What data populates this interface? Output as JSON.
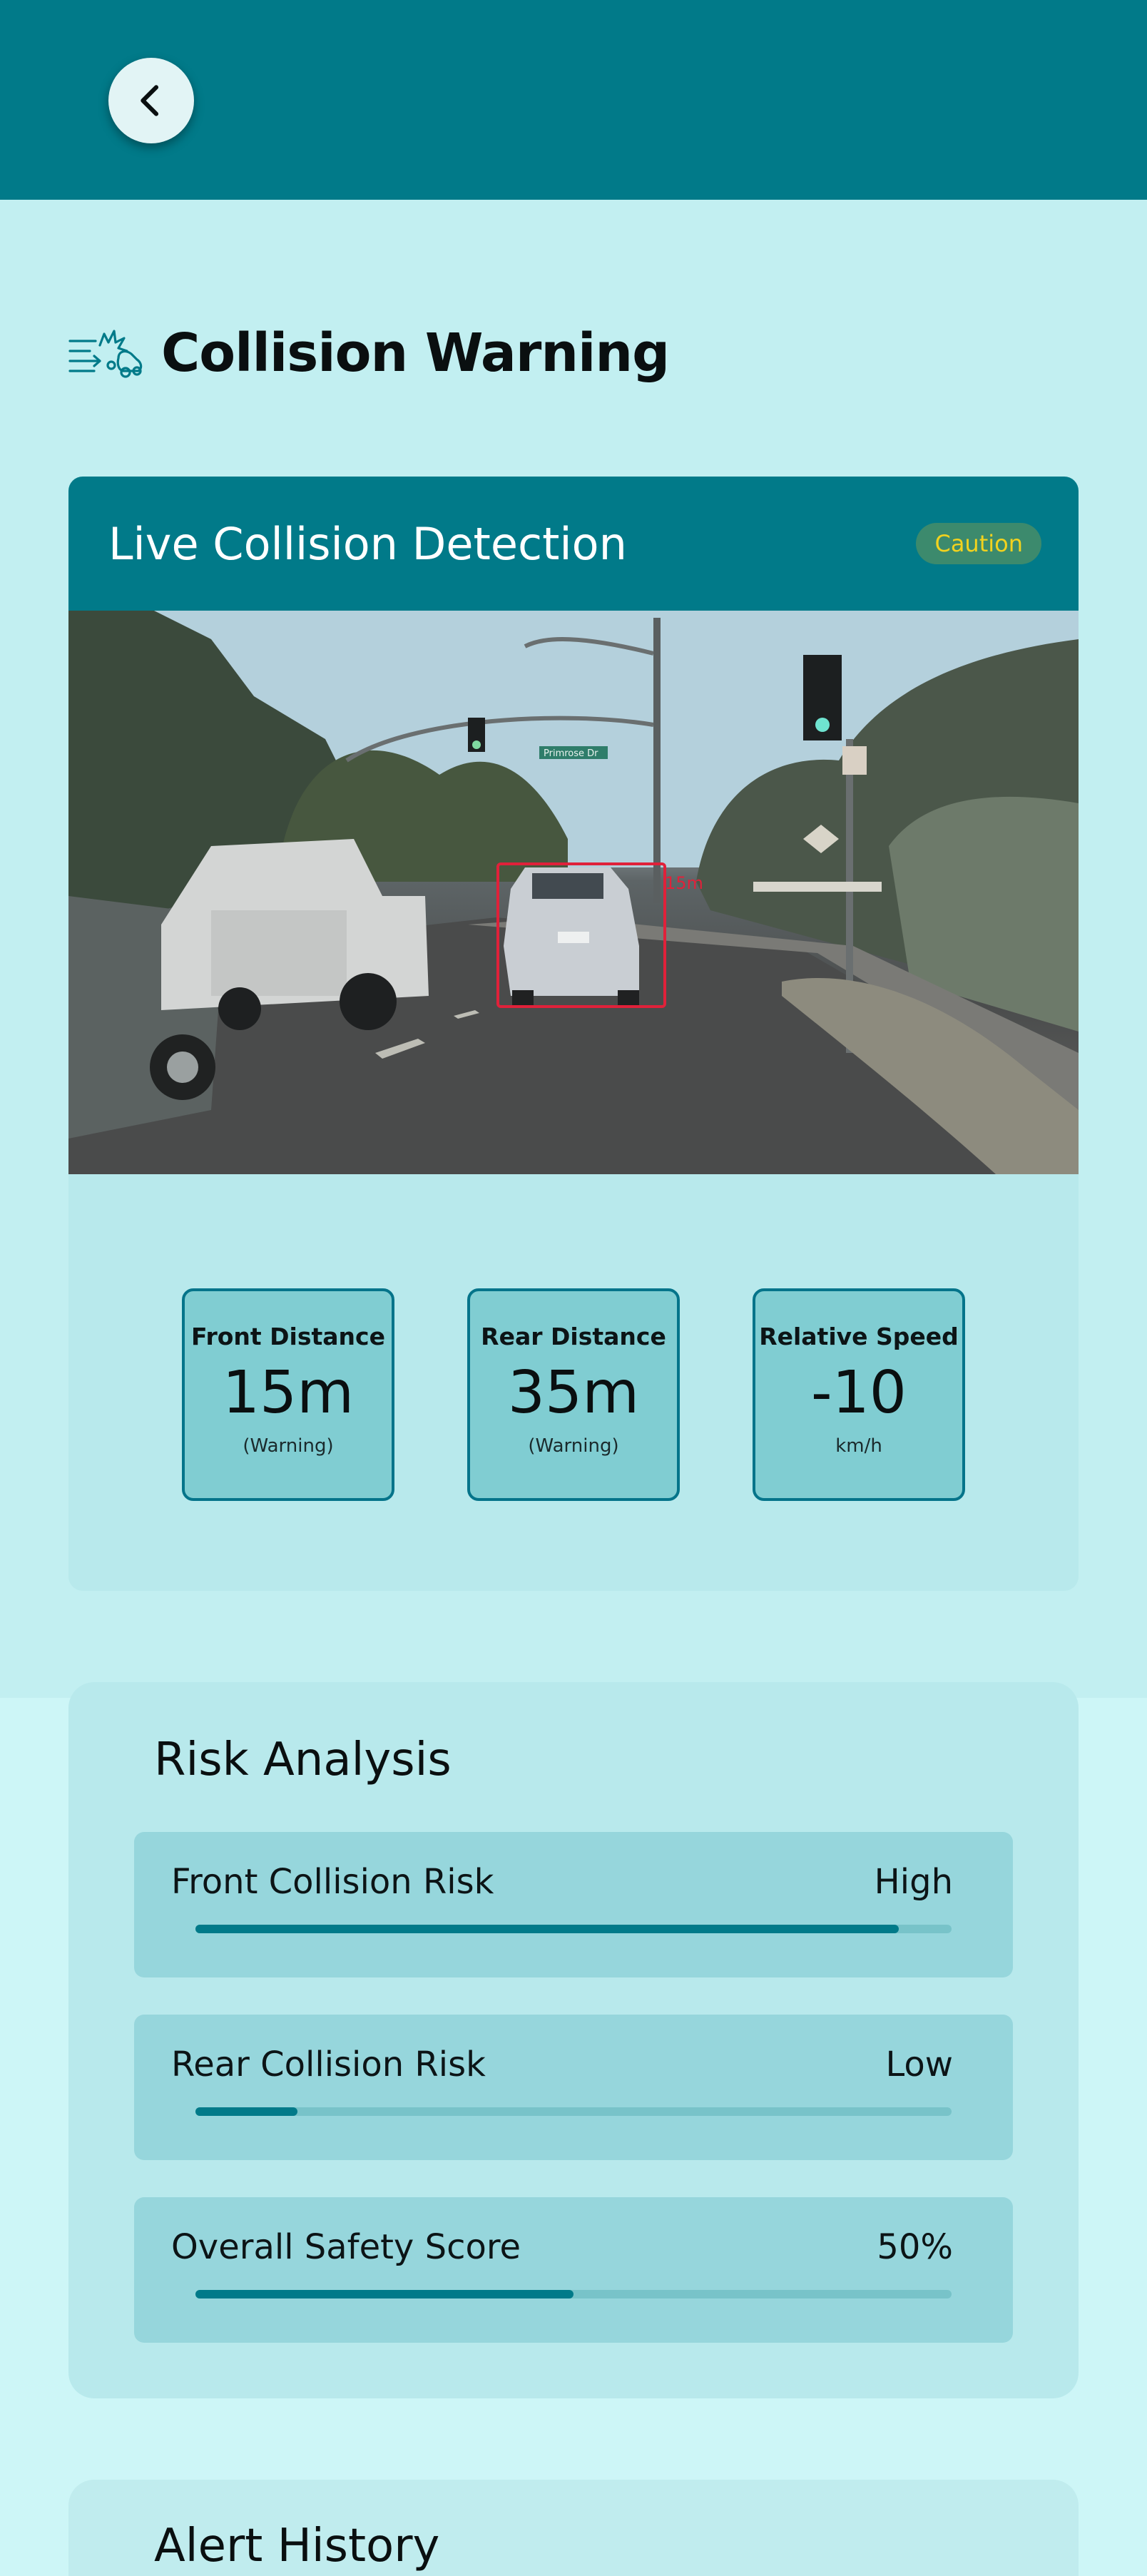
{
  "header": {
    "back_icon": "chevron-left-icon"
  },
  "page": {
    "title": "Collision Warning",
    "title_icon": "collision-icon"
  },
  "detection": {
    "title": "Live Collision Detection",
    "badge": "Caution",
    "badge_color": "#f2d21e",
    "camera_overlay_label": "15m",
    "street_sign": "Primrose Dr"
  },
  "metrics": [
    {
      "label": "Front Distance",
      "value": "15m",
      "sub": "(Warning)"
    },
    {
      "label": "Rear Distance",
      "value": "35m",
      "sub": "(Warning)"
    },
    {
      "label": "Relative Speed",
      "value": "-10",
      "sub": "km/h"
    }
  ],
  "risk": {
    "title": "Risk Analysis",
    "items": [
      {
        "label": "Front Collision Risk",
        "value": "High",
        "level": 0.93
      },
      {
        "label": "Rear Collision Risk",
        "value": "Low",
        "level": 0.135
      },
      {
        "label": "Overall Safety Score",
        "value": "50%",
        "level": 0.5
      }
    ]
  },
  "alerts": {
    "title": "Alert History"
  },
  "colors": {
    "primary": "#017a89",
    "background": "#cdf6f7",
    "card": "#b8e9ec"
  }
}
